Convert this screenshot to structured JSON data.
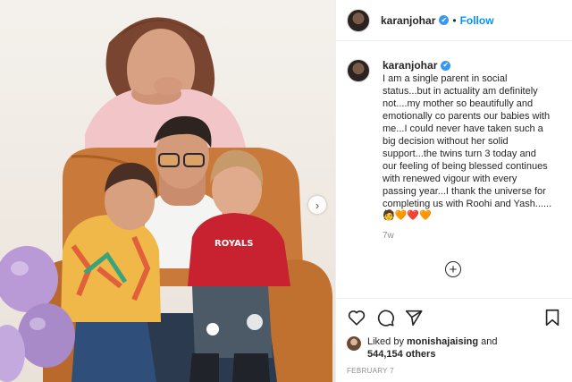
{
  "post": {
    "header": {
      "username": "karanjohar",
      "verified_badge": "✔",
      "separator": "•",
      "follow_label": "Follow"
    },
    "caption": {
      "username": "karanjohar",
      "verified_badge": "✔",
      "text": "I am a single parent in social status...but in actuality am definitely not....my mother so beautifully and emotionally co parents our babies with me...I could never have taken such a big decision without her solid support...the twins turn 3 today and our feeling of being blessed continues with renewed vigour with every passing year...I thank the universe for completing us with Roohi and Yash......",
      "emojis": "🧑‍🧡❤️🧡",
      "time_ago": "7w"
    },
    "load_more_label": "+",
    "carousel_next_label": "›",
    "likes": {
      "prefix": "Liked by ",
      "liker": "monishajaising",
      "conjunction": " and",
      "others": "544,154 others"
    },
    "date": "FEBRUARY 7",
    "icons": {
      "like": "heart-icon",
      "comment": "comment-icon",
      "share": "share-icon",
      "save": "bookmark-icon"
    }
  }
}
